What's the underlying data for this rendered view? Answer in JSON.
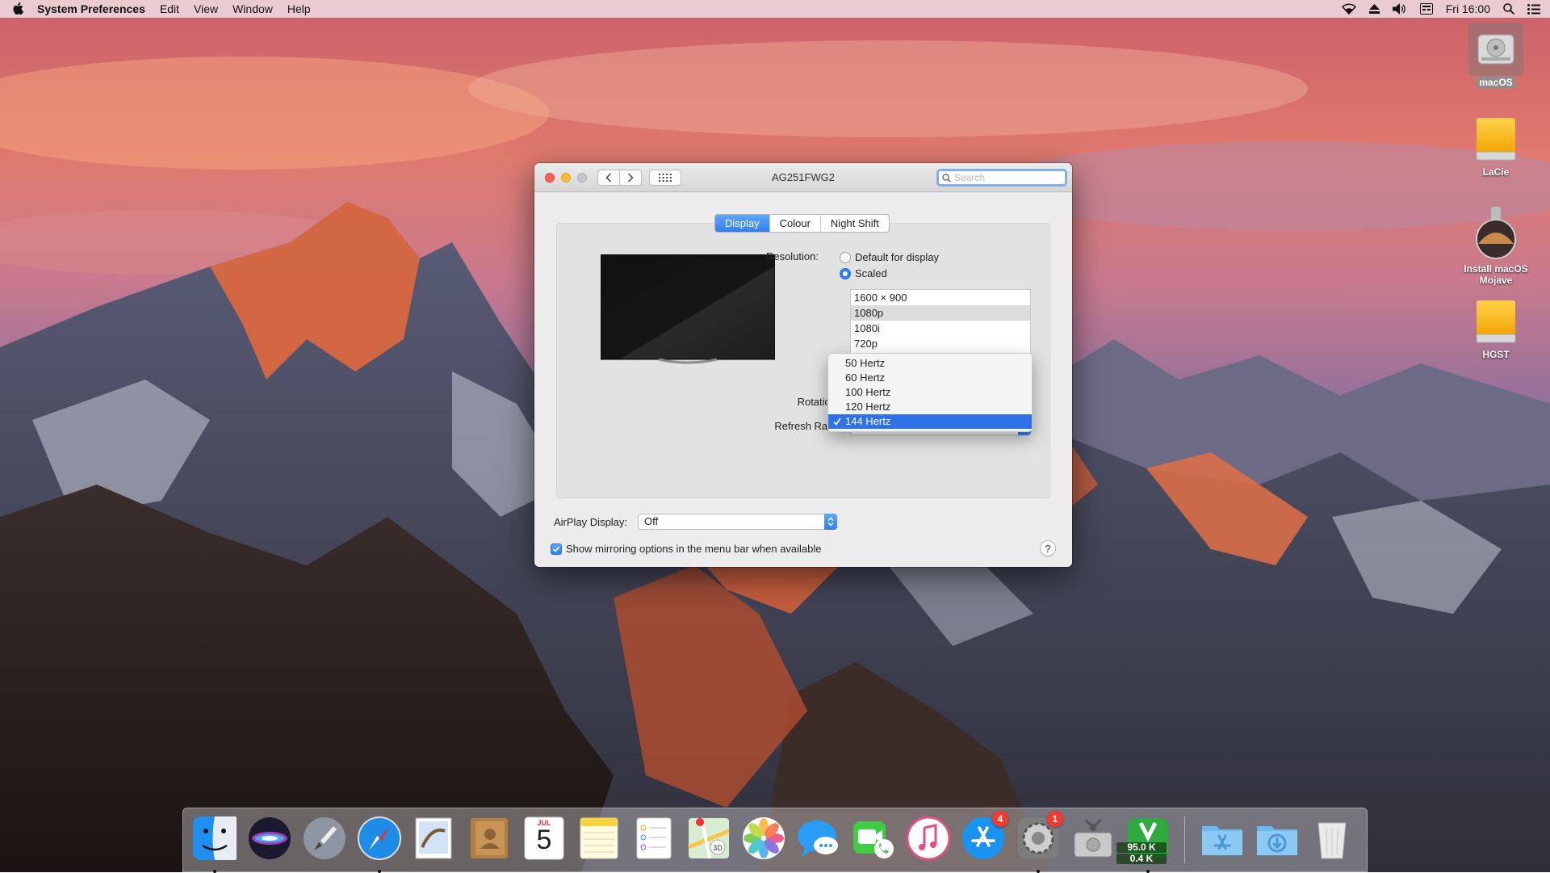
{
  "menubar": {
    "app_name": "System Preferences",
    "menus": [
      "Edit",
      "View",
      "Window",
      "Help"
    ],
    "clock": "Fri 16:00",
    "status_icons": [
      "wifi-icon",
      "eject-icon",
      "volume-icon",
      "keyboard-layout-icon",
      "spotlight-search-icon",
      "notification-center-icon"
    ]
  },
  "desktop": {
    "icons": [
      {
        "label": "macOS",
        "icon": "hard-drive-icon"
      },
      {
        "label": "LaCie",
        "icon": "external-drive-icon"
      },
      {
        "label": "Install macOS Mojave",
        "icon": "installer-icon"
      },
      {
        "label": "HGST",
        "icon": "external-drive-icon"
      }
    ]
  },
  "window": {
    "title": "AG251FWG2",
    "search_placeholder": "Search",
    "tabs": [
      {
        "label": "Display",
        "active": true
      },
      {
        "label": "Colour",
        "active": false
      },
      {
        "label": "Night Shift",
        "active": false
      }
    ],
    "resolution": {
      "label": "Resolution:",
      "options": [
        {
          "label": "Default for display",
          "selected": false
        },
        {
          "label": "Scaled",
          "selected": true
        }
      ],
      "list": [
        {
          "label": "1600 × 900",
          "selected": false
        },
        {
          "label": "1080p",
          "selected": true
        },
        {
          "label": "1080i",
          "selected": false
        },
        {
          "label": "720p",
          "selected": false
        }
      ]
    },
    "rotation": {
      "label": "Rotation"
    },
    "refresh_rate": {
      "label": "Refresh Rate",
      "options": [
        {
          "label": "50 Hertz",
          "selected": false
        },
        {
          "label": "60 Hertz",
          "selected": false
        },
        {
          "label": "100 Hertz",
          "selected": false
        },
        {
          "label": "120 Hertz",
          "selected": false
        },
        {
          "label": "144 Hertz",
          "selected": true
        }
      ]
    },
    "airplay": {
      "label": "AirPlay Display:",
      "value": "Off"
    },
    "mirroring": {
      "label": "Show mirroring options in the menu bar when available",
      "checked": true
    },
    "help": "?"
  },
  "dock": {
    "apps": [
      {
        "name": "Finder",
        "running": true
      },
      {
        "name": "Siri",
        "running": false
      },
      {
        "name": "Launchpad",
        "running": false
      },
      {
        "name": "Safari",
        "running": true
      },
      {
        "name": "Mail",
        "running": false
      },
      {
        "name": "Contacts",
        "running": false
      },
      {
        "name": "Calendar",
        "running": false,
        "month": "JUL",
        "day": "5"
      },
      {
        "name": "Notes",
        "running": false
      },
      {
        "name": "Reminders",
        "running": false
      },
      {
        "name": "Maps",
        "running": false
      },
      {
        "name": "Photos",
        "running": false
      },
      {
        "name": "Messages",
        "running": false
      },
      {
        "name": "FaceTime",
        "running": false
      },
      {
        "name": "iTunes",
        "running": false
      },
      {
        "name": "App Store",
        "running": false,
        "badge": "4"
      },
      {
        "name": "System Preferences",
        "running": true,
        "badge": "1"
      },
      {
        "name": "Disk Utility",
        "running": false
      },
      {
        "name": "Network Monitor",
        "running": true,
        "up": "95.0 K",
        "down": "0.4 K"
      }
    ],
    "folders": [
      "Applications",
      "Downloads",
      "Trash"
    ]
  },
  "colors": {
    "accent": "#2f7ef2",
    "badge": "#f23a2f",
    "window_bg": "#ececec"
  }
}
